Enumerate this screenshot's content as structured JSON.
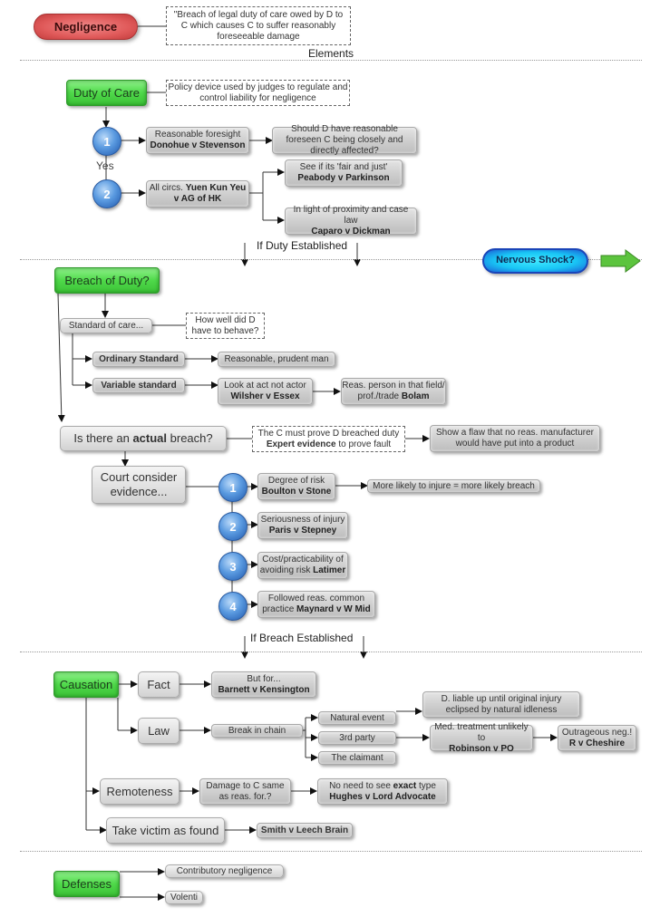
{
  "title": {
    "main_node": "Negligence",
    "definition": "\"Breach of legal duty of care owed by D to C which causes C to suffer reasonably foreseeable damage",
    "elements_label": "Elements"
  },
  "duty_of_care": {
    "node": "Duty of Care",
    "note": "Policy device used by judges to regulate and control liability for negligence",
    "step1": {
      "number": "1",
      "box_text": "Reasonable foresight",
      "box_case": "Donohue v Stevenson",
      "result": "Should D have reasonable foreseen C being closely and directly affected?"
    },
    "yes_label": "Yes",
    "step2": {
      "number": "2",
      "box_text": "All circs.",
      "box_case": "Yuen Kun Yeu v AG of HK",
      "branch_a_text": "See if its 'fair and just'",
      "branch_a_case": "Peabody v Parkinson",
      "branch_b_text": "In light of proximity and case law",
      "branch_b_case": "Caparo v Dickman"
    },
    "transition": "If Duty Established",
    "nervous_shock": "Nervous Shock?"
  },
  "breach": {
    "node": "Breach of Duty?",
    "standard_of_care": "Standard of care...",
    "standard_note": "How well did D have to behave?",
    "ordinary": "Ordinary Standard",
    "ordinary_result": "Reasonable, prudent man",
    "variable": "Variable standard",
    "variable_text": "Look at act not actor",
    "variable_case": "Wilsher v Essex",
    "variable_result_text": "Reas. person in that field/ prof./trade",
    "variable_result_case": "Bolam",
    "actual_breach_pre": "Is there an",
    "actual_breach_bold": "actual",
    "actual_breach_post": "breach?",
    "prove_note_text": "The C must prove D breached duty",
    "prove_note_bold": "Expert evidence",
    "prove_note_post": "to prove fault",
    "flaw_result": "Show a flaw that no reas. manufacturer would have put into a product",
    "court": "Court consider evidence...",
    "factors": [
      {
        "number": "1",
        "text": "Degree of risk",
        "case": "Boulton v Stone",
        "result": "More likely to injure = more likely breach"
      },
      {
        "number": "2",
        "text": "Seriousness of injury",
        "case": "Paris v Stepney"
      },
      {
        "number": "3",
        "text": "Cost/practicability of avoiding risk",
        "case": "Latimer"
      },
      {
        "number": "4",
        "text": "Followed reas. common practice",
        "case": "Maynard v W Mid"
      }
    ],
    "transition": "If Breach Established"
  },
  "causation": {
    "node": "Causation",
    "fact": "Fact",
    "fact_text": "But for...",
    "fact_case": "Barnett v Kensington",
    "law": "Law",
    "break_chain": "Break in chain",
    "natural_event": "Natural event",
    "natural_result": "D. liable up until original injury eclipsed by natural idleness",
    "third_party": "3rd party",
    "third_result_text": "Med. treatment unlikely to",
    "third_result_case": "Robinson v PO",
    "outrageous_text": "Outrageous neg.!",
    "outrageous_case": "R v Cheshire",
    "claimant": "The claimant",
    "remoteness": "Remoteness",
    "remoteness_q": "Damage to C same as reas. for.?",
    "remoteness_result_pre": "No need to see",
    "remoteness_result_bold": "exact",
    "remoteness_result_post": "type",
    "remoteness_case": "Hughes v Lord Advocate",
    "victim": "Take victim as found",
    "victim_case": "Smith v Leech Brain"
  },
  "defenses": {
    "node": "Defenses",
    "items": [
      "Contributory negligence",
      "Volenti"
    ]
  },
  "colors": {
    "green_node": "#4fd94a",
    "red_node": "#e05a5a",
    "cyan_node": "#19c6f5",
    "circle_blue": "#2a64b6",
    "grey_box": "#cfcfcf"
  }
}
